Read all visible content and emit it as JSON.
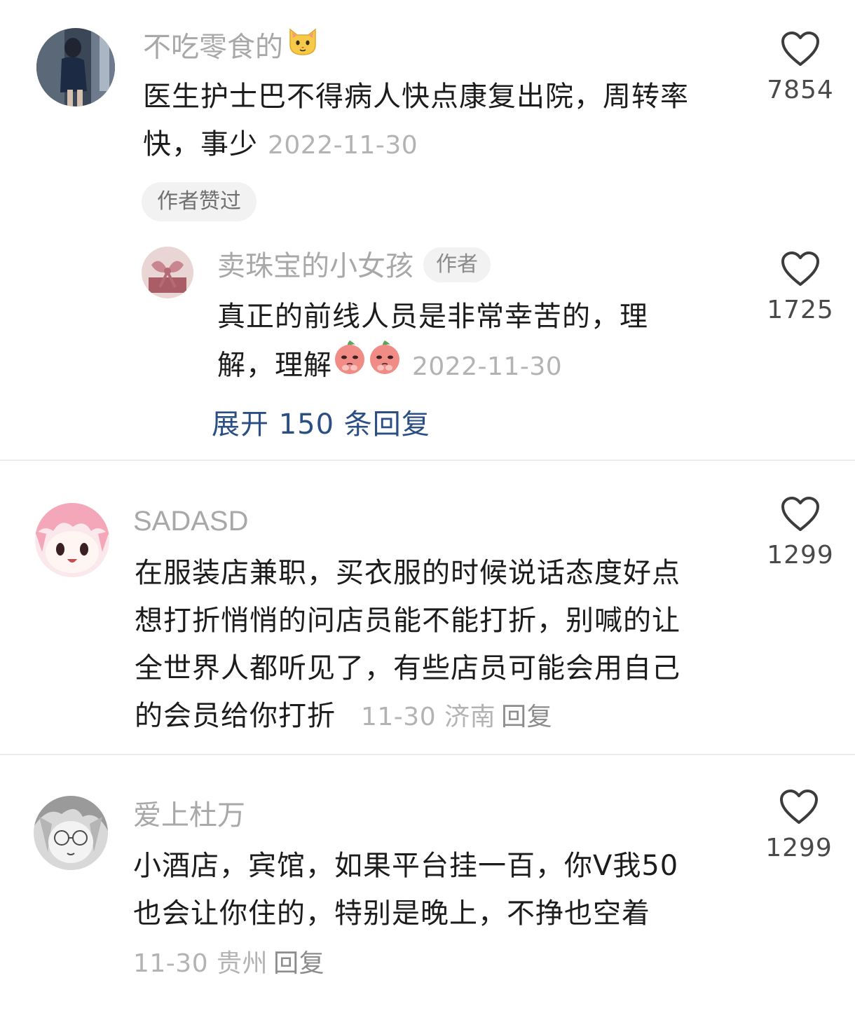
{
  "comments": [
    {
      "username": "不吃零食的",
      "username_emoji": "cat-face",
      "text_line1": "医生护士巴不得病人快点康复出院，周转率",
      "text_line2": "快，事少",
      "date": "2022-11-30",
      "badge": "作者赞过",
      "likes": "7854",
      "reply": {
        "username": "卖珠宝的小女孩",
        "author_tag": "作者",
        "text_line1": "真正的前线人员是非常幸苦的，理",
        "text_line2": "解，理解",
        "emojis": [
          "pleading-peach",
          "pleading-peach"
        ],
        "date": "2022-11-30",
        "likes": "1725"
      },
      "expand_label": "展开 150 条回复"
    },
    {
      "username": "SADASD",
      "text_lines": [
        "在服装店兼职，买衣服的时候说话态度好点",
        "想打折悄悄的问店员能不能打折，别喊的让",
        "全世界人都听见了，有些店员可能会用自己",
        "的会员给你打折"
      ],
      "date": "11-30",
      "location": "济南",
      "reply_label": "回复",
      "likes": "1299"
    },
    {
      "username": "爱上杜万",
      "text_lines": [
        "小酒店，宾馆，如果平台挂一百，你V我50",
        "也会让你住的，特别是晚上，不挣也空着"
      ],
      "date": "11-30",
      "location": "贵州",
      "reply_label": "回复",
      "likes": "1299"
    }
  ],
  "colors": {
    "username": "#a8a8a8",
    "text": "#1c1c1c",
    "meta": "#b3b3b3",
    "link": "#2b4e84",
    "divider": "#ececec"
  },
  "icons": [
    "heart-outline-icon"
  ]
}
